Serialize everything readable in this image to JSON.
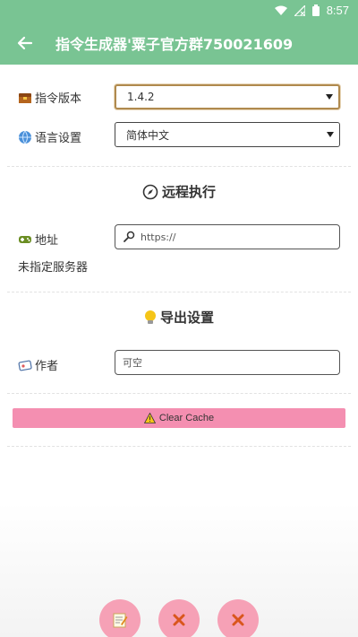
{
  "status_bar": {
    "time": "8:57"
  },
  "header": {
    "title": "指令生成器'粟子官方群750021609"
  },
  "settings": {
    "version_label": "指令版本",
    "version_value": "1.4.2",
    "language_label": "语言设置",
    "language_value": "简体中文"
  },
  "remote": {
    "section_title": "远程执行",
    "address_label": "地址",
    "address_placeholder": "https://",
    "server_status": "未指定服务器"
  },
  "export": {
    "section_title": "导出设置",
    "author_label": "作者",
    "author_value": "可空"
  },
  "actions": {
    "clear_cache_label": "Clear Cache"
  },
  "colors": {
    "accent": "#79c493",
    "button_pink": "#f48fb1",
    "fab_pink": "#f6a1b6"
  }
}
